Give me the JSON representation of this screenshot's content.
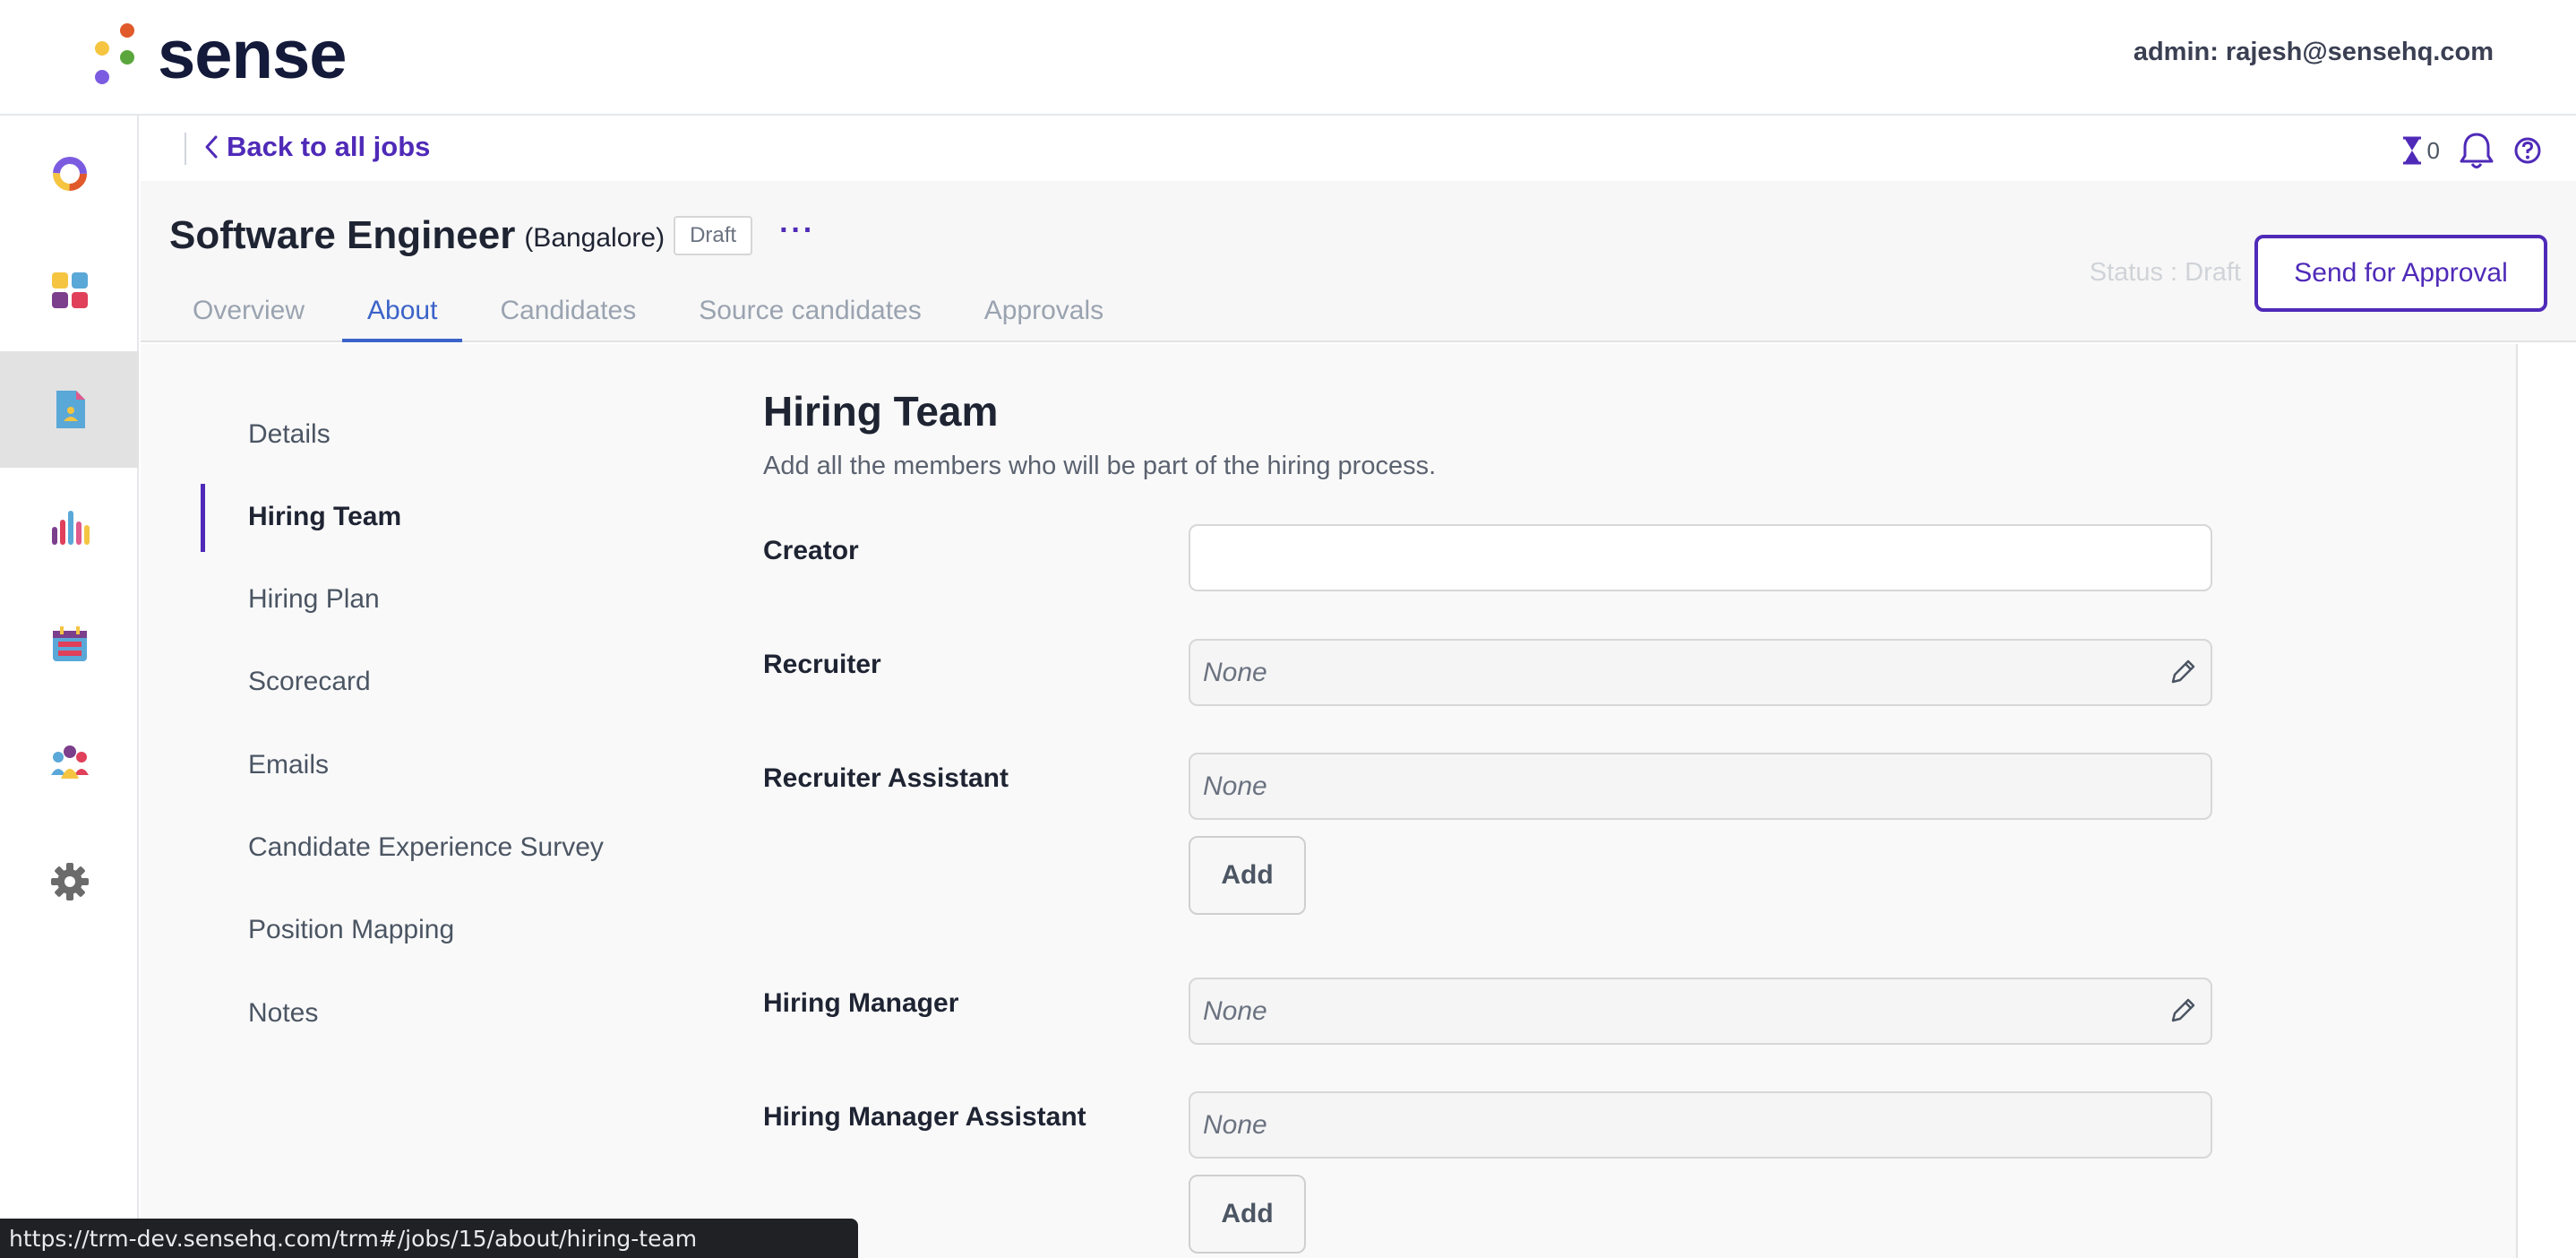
{
  "brand": {
    "name": "sense"
  },
  "topbar": {
    "admin_label": "admin: rajesh@sensehq.com"
  },
  "rail": {
    "items": [
      {
        "icon": "donut-chart-icon"
      },
      {
        "icon": "dashboard-grid-icon"
      },
      {
        "icon": "job-document-icon",
        "active": true
      },
      {
        "icon": "bar-chart-icon"
      },
      {
        "icon": "calendar-icon"
      },
      {
        "icon": "people-icon"
      },
      {
        "icon": "gear-icon"
      }
    ]
  },
  "subheader": {
    "back_label": "Back to all jobs",
    "pending_count": "0"
  },
  "job": {
    "title": "Software Engineer",
    "location": "(Bangalore)",
    "badge": "Draft",
    "more": "···",
    "status_text": "Status : Draft",
    "approval_button": "Send for Approval",
    "tabs": [
      {
        "label": "Overview"
      },
      {
        "label": "About",
        "active": true
      },
      {
        "label": "Candidates"
      },
      {
        "label": "Source candidates"
      },
      {
        "label": "Approvals"
      }
    ]
  },
  "side_nav": {
    "items": [
      {
        "label": "Details"
      },
      {
        "label": "Hiring Team",
        "active": true
      },
      {
        "label": "Hiring Plan"
      },
      {
        "label": "Scorecard"
      },
      {
        "label": "Emails"
      },
      {
        "label": "Candidate Experience Survey"
      },
      {
        "label": "Position Mapping"
      },
      {
        "label": "Notes"
      }
    ]
  },
  "hiring_team": {
    "title": "Hiring Team",
    "subtitle": "Add all the members who will be part of the hiring process.",
    "fields": {
      "creator": {
        "label": "Creator",
        "value": ""
      },
      "recruiter": {
        "label": "Recruiter",
        "value": "None"
      },
      "recruiter_assistant": {
        "label": "Recruiter Assistant",
        "value": "None"
      },
      "hiring_manager": {
        "label": "Hiring Manager",
        "value": "None"
      },
      "hiring_manager_assistant": {
        "label": "Hiring Manager Assistant",
        "value": "None"
      }
    },
    "add_label": "Add"
  },
  "browser_status": {
    "url": "https://trm-dev.sensehq.com/trm#/jobs/15/about/hiring-team"
  },
  "colors": {
    "accent": "#4f2ab8",
    "tab_active": "#3b63c9",
    "logo_dots": [
      "#f5c542",
      "#e05a2b",
      "#5aa63c",
      "#7b5ce0"
    ]
  }
}
